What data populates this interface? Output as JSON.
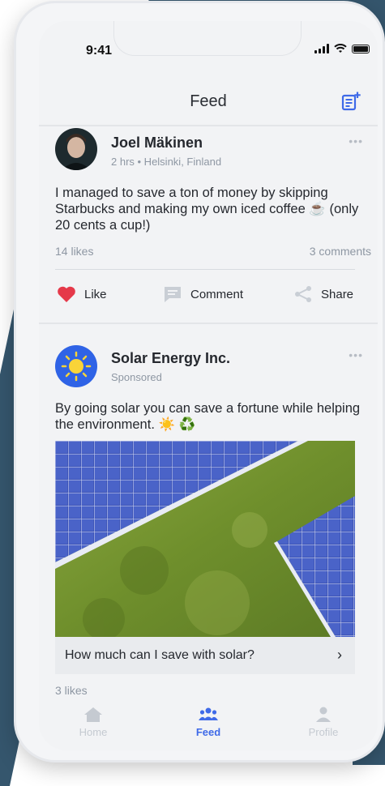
{
  "status": {
    "time": "9:41"
  },
  "header": {
    "title": "Feed"
  },
  "posts": [
    {
      "author": "Joel Mäkinen",
      "meta": "2 hrs • Helsinki, Finland",
      "text": "I managed to save a ton of money by skipping Starbucks and making my own iced coffee ☕ (only 20 cents a cup!)",
      "likes": "14 likes",
      "comments": "3 comments",
      "actions": {
        "like": "Like",
        "comment": "Comment",
        "share": "Share"
      }
    },
    {
      "author": "Solar Energy Inc.",
      "meta": "Sponsored",
      "text": "By going solar you can save a fortune while helping the environment. ☀️ ♻️",
      "cta": "How much can I save with solar?",
      "likes": "3 likes"
    }
  ],
  "tabs": [
    {
      "label": "Home",
      "icon": "home-icon"
    },
    {
      "label": "Feed",
      "icon": "people-icon"
    },
    {
      "label": "Profile",
      "icon": "person-icon"
    }
  ],
  "colors": {
    "accent": "#3f6ae8",
    "like": "#e5394a",
    "backdrop": "#35566d",
    "sponsor_logo": "#2f63e6"
  }
}
